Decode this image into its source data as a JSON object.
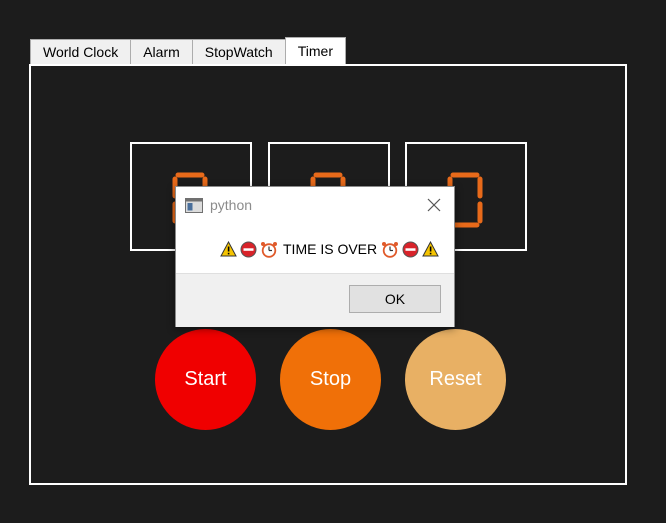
{
  "tabs": [
    "World Clock",
    "Alarm",
    "StopWatch",
    "Timer"
  ],
  "active_tab": "Timer",
  "timer": {
    "digits": [
      "0",
      "0",
      "0"
    ],
    "digit_color": "#e86a1a"
  },
  "buttons": {
    "start": {
      "label": "Start",
      "color": "#f00000"
    },
    "stop": {
      "label": "Stop",
      "color": "#f07008"
    },
    "reset": {
      "label": "Reset",
      "color": "#e8b064"
    }
  },
  "dialog": {
    "title": "python",
    "message": "TIME IS OVER",
    "message_icons_left": [
      "warning-icon",
      "no-entry-icon",
      "alarm-clock-icon"
    ],
    "message_icons_right": [
      "alarm-clock-icon",
      "no-entry-icon",
      "warning-icon"
    ],
    "ok_label": "OK"
  }
}
